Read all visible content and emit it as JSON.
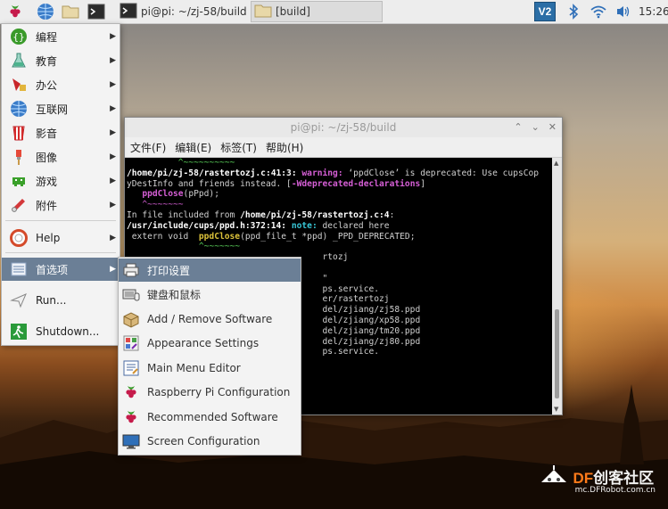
{
  "taskbar": {
    "tasks": [
      {
        "label": "pi@pi: ~/zj-58/build",
        "icon": "terminal-icon"
      },
      {
        "label": "[build]",
        "icon": "folder-icon"
      }
    ],
    "vnc_label": "V2",
    "clock": "15:26"
  },
  "menu": {
    "items": [
      {
        "label": "编程",
        "icon": "programming-icon",
        "submenu": true
      },
      {
        "label": "教育",
        "icon": "education-icon",
        "submenu": true
      },
      {
        "label": "办公",
        "icon": "office-icon",
        "submenu": true
      },
      {
        "label": "互联网",
        "icon": "internet-icon",
        "submenu": true
      },
      {
        "label": "影音",
        "icon": "sound-video-icon",
        "submenu": true
      },
      {
        "label": "图像",
        "icon": "graphics-icon",
        "submenu": true
      },
      {
        "label": "游戏",
        "icon": "games-icon",
        "submenu": true
      },
      {
        "label": "附件",
        "icon": "accessories-icon",
        "submenu": true
      },
      {
        "label": "Help",
        "icon": "help-icon",
        "submenu": true
      },
      {
        "label": "首选项",
        "icon": "preferences-icon",
        "submenu": true,
        "selected": true
      },
      {
        "label": "Run...",
        "icon": "run-icon",
        "submenu": false
      },
      {
        "label": "Shutdown...",
        "icon": "shutdown-icon",
        "submenu": false
      }
    ]
  },
  "submenu": {
    "items": [
      {
        "label": "打印设置",
        "icon": "printer-icon",
        "selected": true
      },
      {
        "label": "键盘和鼠标",
        "icon": "keyboard-mouse-icon"
      },
      {
        "label": "Add / Remove Software",
        "icon": "package-icon"
      },
      {
        "label": "Appearance Settings",
        "icon": "appearance-icon"
      },
      {
        "label": "Main Menu Editor",
        "icon": "menu-editor-icon"
      },
      {
        "label": "Raspberry Pi Configuration",
        "icon": "raspberry-icon"
      },
      {
        "label": "Recommended Software",
        "icon": "raspberry-icon"
      },
      {
        "label": "Screen Configuration",
        "icon": "monitor-icon"
      }
    ]
  },
  "terminal": {
    "title": "pi@pi: ~/zj-58/build",
    "menus": [
      "文件(F)",
      "编辑(E)",
      "标签(T)",
      "帮助(H)"
    ],
    "lines": {
      "l1": "          ^~~~~~~~~~~",
      "l2_path": "/home/pi/zj-58/rastertozj.c:41:3: ",
      "l2_warn": "warning: ",
      "l2_rest": "‘ppdClose’ is deprecated: Use cupsCop",
      "l3_text": "yDestInfo and friends instead. [",
      "l3_flag": "-Wdeprecated-declarations",
      "l3_end": "]",
      "l4_pre": "   ",
      "l4_fn": "ppdClose",
      "l4_rest": "(pPpd);",
      "l5": "   ^~~~~~~~",
      "l6_pre": "In file included from ",
      "l6_path": "/home/pi/zj-58/rastertozj.c:4",
      "l6_end": ":",
      "l7_path": "/usr/include/cups/ppd.h:372:14: ",
      "l7_note": "note: ",
      "l7_rest": "declared here",
      "l8_pre": " extern void  ",
      "l8_fn": "ppdClose",
      "l8_rest": "(ppd_file_t *ppd) _PPD_DEPRECATED;",
      "l9": "              ^~~~~~~~",
      "l10": "                                      rtozj",
      "l11": "                                      \"",
      "l12": "                                      ps.service.",
      "l13": "                                      er/rastertozj",
      "l14": "                                      del/zjiang/zj58.ppd",
      "l15": "                                      del/zjiang/xp58.ppd",
      "l16": "                                      del/zjiang/tm20.ppd",
      "l17": "                                      del/zjiang/zj80.ppd",
      "l18": "                                      ps.service."
    }
  },
  "watermark": {
    "brand_df": "DF",
    "brand_rest": "创客社区",
    "url": "mc.DFRobot.com.cn"
  }
}
